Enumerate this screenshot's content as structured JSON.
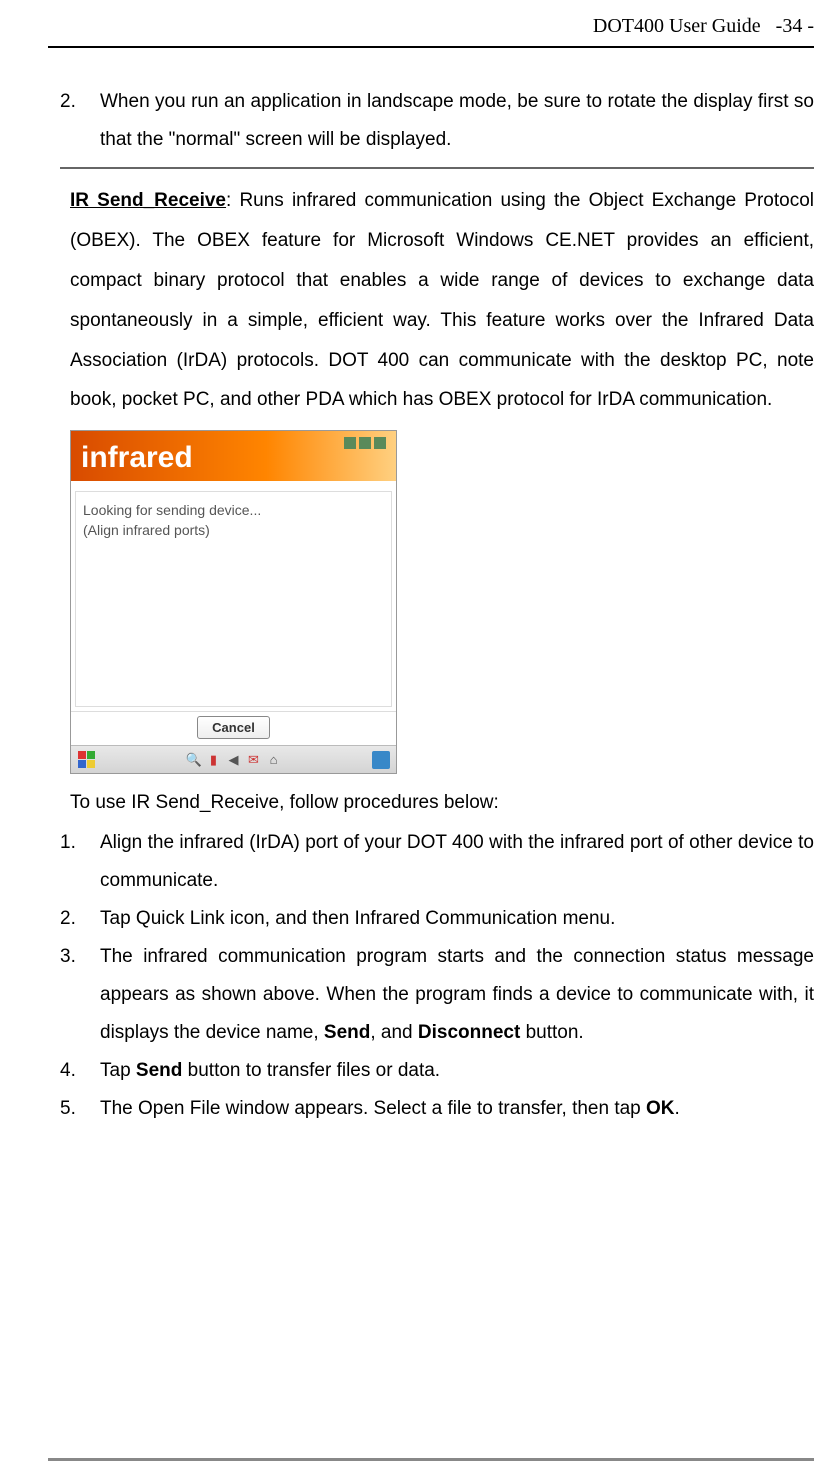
{
  "header": {
    "title": "DOT400 User Guide",
    "page": "-34 -"
  },
  "intro_item": {
    "num": "2.",
    "text": "When you run an application in landscape mode, be sure to rotate the display first so that the \"normal\" screen will be displayed."
  },
  "ir_section": {
    "title": "IR Send_Receive",
    "text": ": Runs infrared communication using the Object Exchange Protocol (OBEX). The OBEX feature for Microsoft Windows CE.NET provides an efficient, compact binary protocol that enables a wide range of devices to exchange data spontaneously in a simple, efficient way. This feature works over the Infrared Data Association (IrDA) protocols. DOT 400 can communicate with the desktop PC, note book, pocket PC, and other PDA which has OBEX protocol for IrDA communication."
  },
  "screenshot": {
    "logo": "infrared",
    "line1": "Looking for sending device...",
    "line2": "(Align infrared ports)",
    "cancel": "Cancel"
  },
  "instructions_intro": "To use IR Send_Receive, follow procedures below:",
  "steps": [
    {
      "num": "1.",
      "parts": [
        {
          "t": "Align the infrared (IrDA) port of your DOT 400 with the infrared port of other device to communicate."
        }
      ],
      "justify": true
    },
    {
      "num": "2.",
      "parts": [
        {
          "t": "Tap Quick Link icon, and then Infrared Communication menu."
        }
      ],
      "justify": false
    },
    {
      "num": "3.",
      "parts": [
        {
          "t": "The infrared communication program starts and the connection status message appears as shown above. When the program finds a device to communicate with, it displays the device name, "
        },
        {
          "t": "Send",
          "b": true
        },
        {
          "t": ", and "
        },
        {
          "t": "Disconnect",
          "b": true
        },
        {
          "t": " button."
        }
      ],
      "justify": true
    },
    {
      "num": "4.",
      "parts": [
        {
          "t": "Tap "
        },
        {
          "t": "Send",
          "b": true
        },
        {
          "t": " button to transfer files or data."
        }
      ],
      "justify": false
    },
    {
      "num": "5.",
      "parts": [
        {
          "t": "The Open File window appears. Select a file to transfer, then tap "
        },
        {
          "t": "OK",
          "b": true
        },
        {
          "t": "."
        }
      ],
      "justify": false
    }
  ]
}
